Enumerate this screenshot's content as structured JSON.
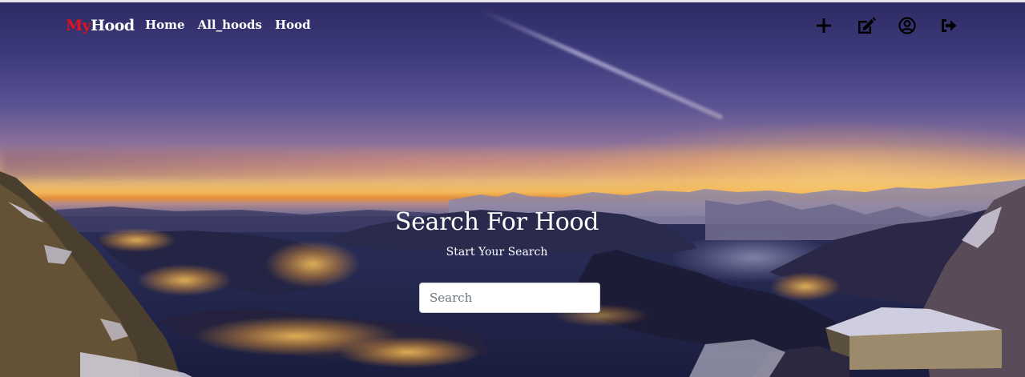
{
  "navbar": {
    "brand_prefix": "My",
    "brand_suffix": "Hood",
    "links": [
      "Home",
      "All_hoods",
      "Hood"
    ],
    "icons": [
      "plus-icon",
      "edit-icon",
      "user-circle-icon",
      "logout-icon"
    ]
  },
  "hero": {
    "title": "Search For Hood",
    "subtitle": "Start Your Search"
  },
  "search": {
    "placeholder": "Search",
    "value": ""
  },
  "colors": {
    "brand_accent": "#e0131e",
    "nav_text": "#ffffff",
    "icon": "#000000"
  }
}
